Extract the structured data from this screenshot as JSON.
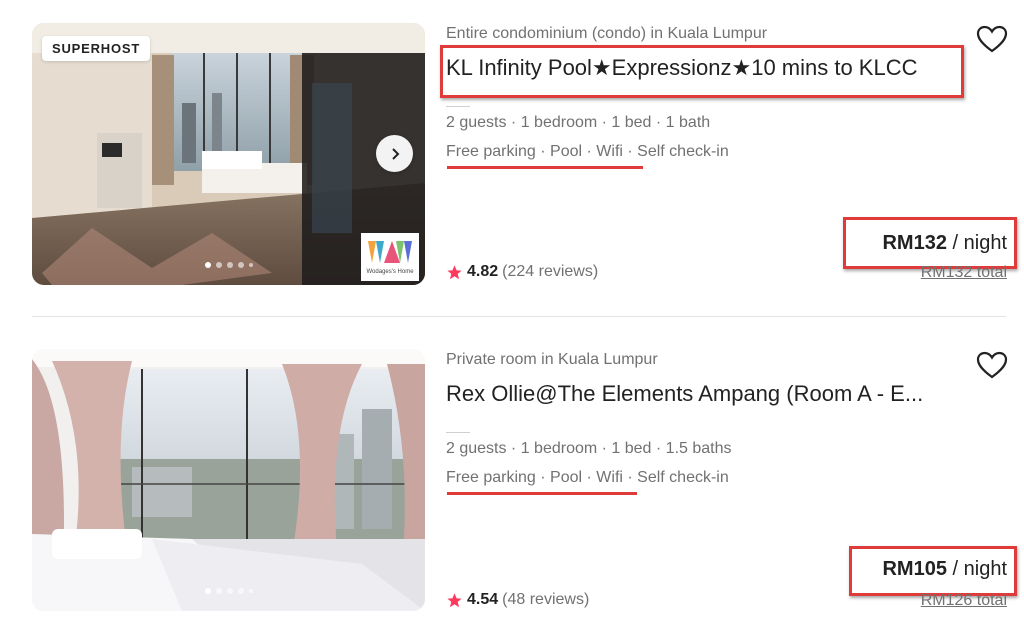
{
  "listings": [
    {
      "type": "Entire condominium (condo) in Kuala Lumpur",
      "title": "KL Infinity Pool★Expressionz★10 mins to KLCC",
      "details": "2 guests · 1 bedroom · 1 bed · 1 bath",
      "amenities": "Free parking · Pool · Wifi · Self check-in",
      "badge": "SUPERHOST",
      "host_logo_caption": "Wodages's Home",
      "price": "RM132",
      "per_night": "/ night",
      "total": "RM132 total",
      "rating": "4.82",
      "reviews": "(224 reviews)",
      "photo_index": 1,
      "photo_count": 5
    },
    {
      "type": "Private room in Kuala Lumpur",
      "title": "Rex Ollie@The Elements Ampang (Room A - E...",
      "details": "2 guests · 1 bedroom · 1 bed · 1.5 baths",
      "amenities": "Free parking · Pool · Wifi · Self check-in",
      "price": "RM105",
      "per_night": "/ night",
      "total": "RM126 total",
      "rating": "4.54",
      "reviews": "(48 reviews)",
      "photo_index": 1,
      "photo_count": 5
    }
  ],
  "icons": {
    "heart": "heart-outline-icon",
    "star": "star-icon",
    "next": "chevron-right-icon"
  },
  "colors": {
    "star": "#ff385c",
    "highlight": "#e03b3b",
    "muted_text": "#717171"
  }
}
